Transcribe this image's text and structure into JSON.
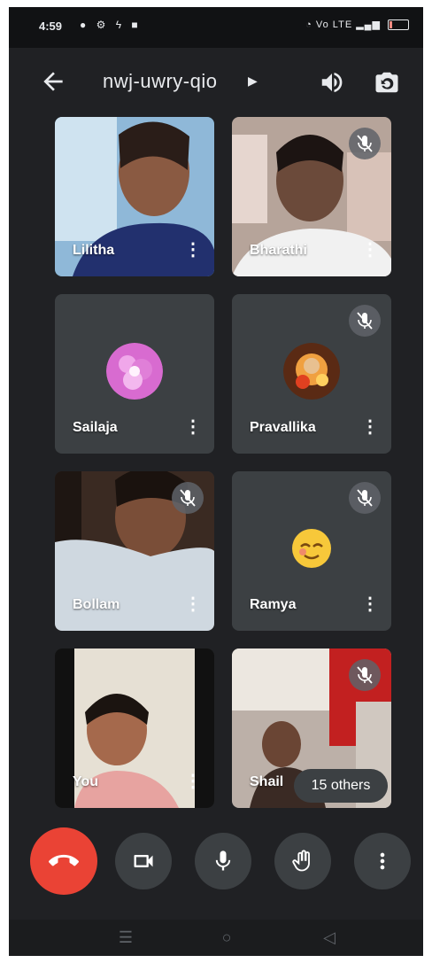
{
  "status_bar": {
    "time": "4:59",
    "left_icons": [
      "whatsapp-icon",
      "settings-icon",
      "notification-icon",
      "app-icon"
    ],
    "right_text": "Vo LTE",
    "battery_fraction": 0.15,
    "battery_color": "#f28b82"
  },
  "header": {
    "meeting_code": "nwj-uwry-qio",
    "back_icon": "arrow-back-icon",
    "speaker_icon": "volume-icon",
    "flip_icon": "camera-flip-icon"
  },
  "participants": [
    {
      "name": "Lilitha",
      "speaking": true,
      "muted": false,
      "kind": "video"
    },
    {
      "name": "Bharathi",
      "speaking": false,
      "muted": true,
      "kind": "video"
    },
    {
      "name": "Sailaja",
      "speaking": false,
      "muted": false,
      "kind": "avatar"
    },
    {
      "name": "Pravallika",
      "speaking": false,
      "muted": true,
      "kind": "avatar"
    },
    {
      "name": "Bollam",
      "speaking": false,
      "muted": true,
      "kind": "video"
    },
    {
      "name": "Ramya",
      "speaking": false,
      "muted": true,
      "kind": "avatar"
    },
    {
      "name": "You",
      "speaking": false,
      "muted": false,
      "kind": "video"
    },
    {
      "name": "Shail",
      "speaking": false,
      "muted": true,
      "kind": "video"
    }
  ],
  "others_count_label": "15 others",
  "controls": {
    "end_call": "call-end-icon",
    "camera": "videocam-icon",
    "microphone": "mic-icon",
    "raise_hand": "raise-hand-icon",
    "more": "more-vert-icon"
  },
  "colors": {
    "background": "#202124",
    "tile": "#3c4043",
    "end_call": "#ea4335",
    "speaking_border": "#0f5257"
  }
}
